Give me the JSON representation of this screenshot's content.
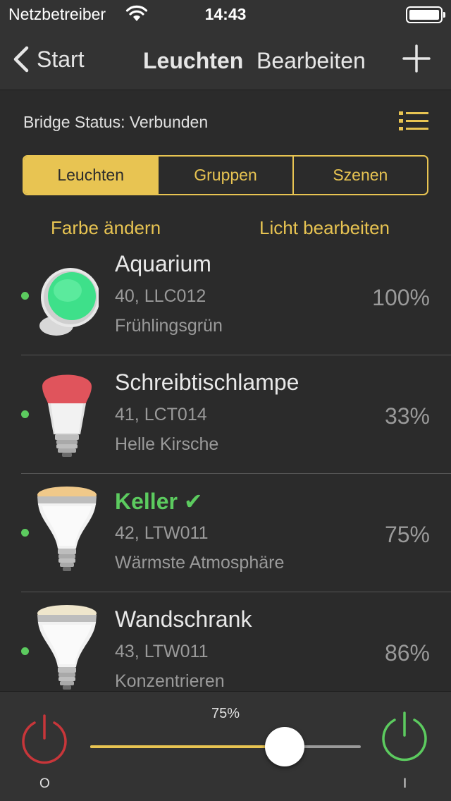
{
  "status_bar": {
    "carrier": "Netzbetreiber",
    "time": "14:43",
    "wifi_icon": "wifi-icon",
    "battery_icon": "battery-icon"
  },
  "nav": {
    "back_label": "Start",
    "title": "Leuchten",
    "edit_label": "Bearbeiten",
    "add_icon": "plus-icon"
  },
  "bridge_status": "Bridge Status: Verbunden",
  "segments": [
    {
      "label": "Leuchten",
      "active": true
    },
    {
      "label": "Gruppen",
      "active": false
    },
    {
      "label": "Szenen",
      "active": false
    }
  ],
  "links": {
    "change_color": "Farbe ändern",
    "edit_light": "Licht bearbeiten"
  },
  "lights": [
    {
      "name": "Aquarium",
      "id_model": "40, LLC012",
      "scene": "Frühlingsgrün",
      "brightness": "100%",
      "bulb": "round-bloom-lamp-icon",
      "color": "#3ee08a",
      "on": true,
      "selected": false
    },
    {
      "name": "Schreibtischlampe",
      "id_model": "41, LCT014",
      "scene": "Helle Kirsche",
      "brightness": "33%",
      "bulb": "a19-bulb-icon",
      "color": "#e0545c",
      "on": true,
      "selected": false
    },
    {
      "name": "Keller ✔",
      "id_model": "42, LTW011",
      "scene": "Wärmste Atmosphäre",
      "brightness": "75%",
      "bulb": "br30-flood-bulb-icon",
      "color": "#f0c98a",
      "on": true,
      "selected": true
    },
    {
      "name": "Wandschrank",
      "id_model": "43, LTW011",
      "scene": "Konzentrieren",
      "brightness": "86%",
      "bulb": "br30-flood-bulb-icon",
      "color": "#efe6cc",
      "on": true,
      "selected": false
    }
  ],
  "bottom": {
    "slider_label": "75%",
    "slider_value": 0.72,
    "off_label": "O",
    "on_label": "I",
    "off_color": "#c8363a",
    "on_color": "#5ccb5f"
  },
  "colors": {
    "accent": "#e8c452",
    "background": "#2b2b2b",
    "bar": "#333333"
  }
}
